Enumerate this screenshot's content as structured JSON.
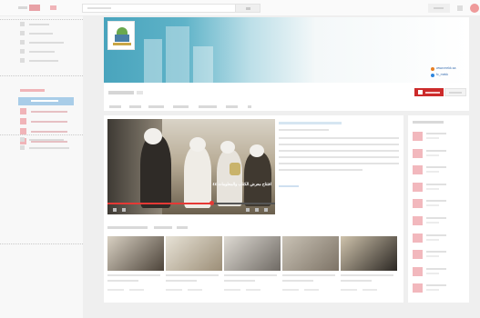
{
  "banner": {
    "links": [
      {
        "text": "www.mekk.sa",
        "color": "#e67e22"
      },
      {
        "text": "fc_mekk",
        "color": "#2e86de"
      }
    ]
  },
  "video": {
    "title": "افتتاح معرض الكتاب والمعلومات ٤٤",
    "progress": 0.62
  },
  "related": [
    {
      "title": "",
      "colors": [
        "#4d443a",
        "#d8d0c2"
      ]
    },
    {
      "title": "",
      "colors": [
        "#9c8e77",
        "#e7e2d6"
      ]
    },
    {
      "title": "",
      "colors": [
        "#6f6a64",
        "#dedad3"
      ]
    },
    {
      "title": "",
      "colors": [
        "#7d7366",
        "#c9c2b5"
      ]
    },
    {
      "title": "",
      "colors": [
        "#2b2723",
        "#cfc3ac"
      ]
    }
  ],
  "colors": {
    "accent": "#cc2b2b",
    "sidebar_active": "#a9cde8",
    "placeholder": "#e3e3e3"
  },
  "icons": [
    "menu-icon",
    "search-icon",
    "upload-icon",
    "apps-icon",
    "avatar-icon",
    "subscribe-icon",
    "play-icon",
    "volume-icon",
    "settings-icon",
    "fullscreen-icon"
  ]
}
